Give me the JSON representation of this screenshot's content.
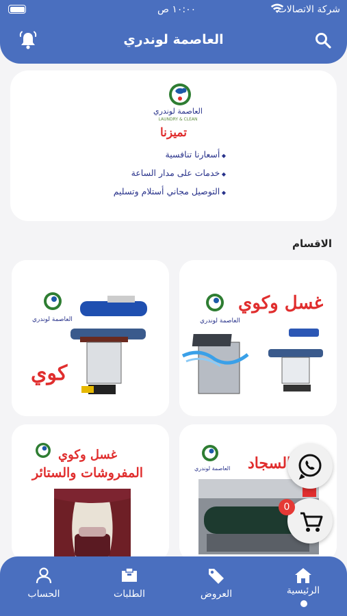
{
  "status_bar": {
    "carrier": "شركة الاتصالات",
    "time": "١٠:٠٠ ص"
  },
  "header": {
    "title": "العاصمة لوندري"
  },
  "banner": {
    "logo_name": "العاصمة لوندري",
    "logo_subtitle": "LAUNDRY & CLEAN",
    "tagline": "تميزنا",
    "features": [
      "أسعارنا تنافسية",
      "خدمات على مدار الساعة",
      "التوصيل مجاني أستلام وتسليم"
    ]
  },
  "sections": {
    "title": "الاقسام"
  },
  "categories": [
    {
      "text": "غسل وكوي",
      "logo_name": "العاصمة لوندري"
    },
    {
      "text": "كوي",
      "logo_name": "العاصمة لوندري"
    },
    {
      "text": "السجاد",
      "logo_name": "العاصمة لوندري"
    },
    {
      "text": "غسل وكوي",
      "text2": "المفروشات والستائر",
      "logo_name": "العاصمة لوندري"
    }
  ],
  "cart": {
    "count": "0"
  },
  "bottom_nav": {
    "home": "الرئيسية",
    "offers": "العروض",
    "orders": "الطلبات",
    "account": "الحساب"
  },
  "colors": {
    "primary": "#4a6fbf",
    "accent_red": "#e02e2e",
    "navy": "#27318a",
    "whatsapp": "#25d366"
  }
}
